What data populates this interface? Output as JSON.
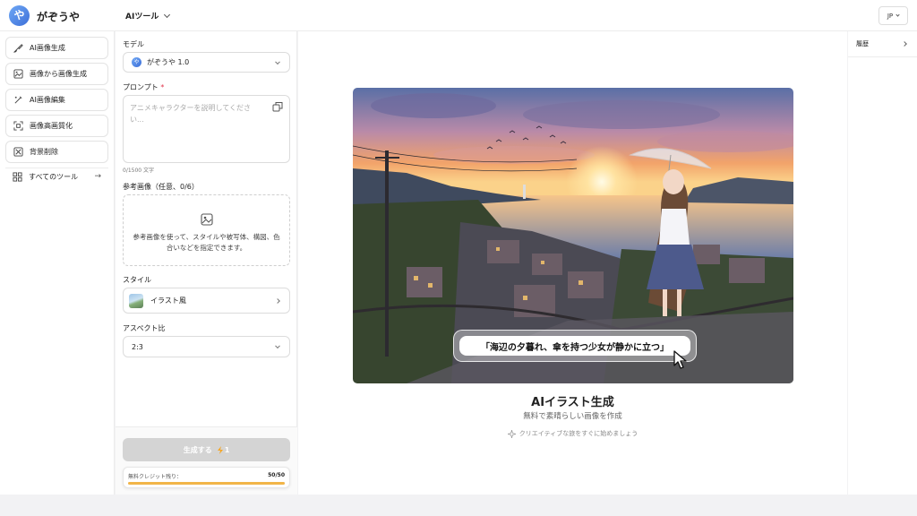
{
  "header": {
    "logo_glyph": "や",
    "brand": "がぞうや",
    "tool_menu": "AIツール",
    "language": "JP"
  },
  "sidebar": {
    "items": [
      {
        "label": "AI画像生成",
        "icon": "brush-icon"
      },
      {
        "label": "画像から画像生成",
        "icon": "image-to-image-icon"
      },
      {
        "label": "AI画像編集",
        "icon": "magic-edit-icon"
      },
      {
        "label": "画像高画質化",
        "icon": "upscale-icon"
      },
      {
        "label": "背景削除",
        "icon": "background-remove-icon"
      }
    ],
    "all_tools": {
      "label": "すべてのツール",
      "icon": "grid-icon",
      "arrow": "→"
    }
  },
  "form": {
    "model_label": "モデル",
    "model_value": "がぞうや 1.0",
    "prompt_label": "プロンプト",
    "required_mark": "*",
    "prompt_placeholder": "アニメキャラクターを説明してください...",
    "char_count": "0/1500 文字",
    "reference_label": "参考画像（任意、0/6）",
    "reference_hint": "参考画像を使って、スタイルや被写体、構図、色合いなどを指定できます。",
    "style_label": "スタイル",
    "style_value": "イラスト風",
    "aspect_label": "アスペクト比",
    "aspect_value": "2:3",
    "generate_label": "生成する",
    "generate_cost": "1",
    "credit_label": "無料クレジット残り：",
    "credit_value": "50/50",
    "credit_fraction": 1.0
  },
  "main": {
    "caption": "「海辺の夕暮れ、傘を持つ少女が静かに立つ」",
    "title": "AIイラスト生成",
    "subtitle": "無料で素晴らしい画像を作成",
    "hint": "クリエイティブな旅をすぐに始めましょう"
  },
  "history": {
    "label": "履歴"
  },
  "colors": {
    "brand": "#3d6fd8",
    "required": "#e0334a",
    "credit_bar": "#f2b548",
    "button_disabled": "#d4d4d4"
  }
}
